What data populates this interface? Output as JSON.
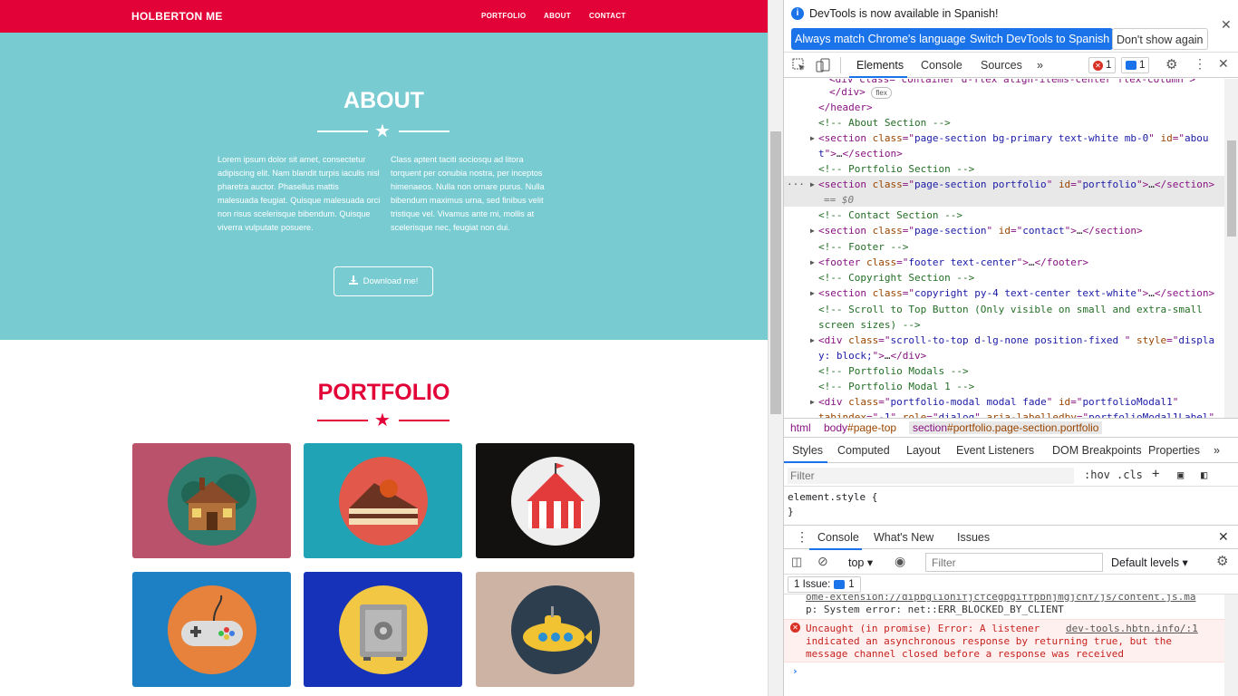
{
  "site": {
    "brand": "HOLBERTON ME",
    "nav": [
      "PORTFOLIO",
      "ABOUT",
      "CONTACT"
    ],
    "about": {
      "title": "ABOUT",
      "col1": "Lorem ipsum dolor sit amet, consectetur adipiscing elit. Nam blandit turpis iaculis nisl pharetra auctor. Phasellus mattis malesuada feugiat. Quisque malesuada orci non risus scelerisque bibendum. Quisque viverra vulputate posuere.",
      "col2": "Class aptent taciti sociosqu ad litora torquent per conubia nostra, per inceptos himenaeos. Nulla non ornare purus. Nulla bibendum maximus urna, sed finibus velit tristique vel. Vivamus ante mi, mollis at scelerisque nec, feugiat non dui.",
      "button": "Download me!"
    },
    "portfolio": {
      "title": "PORTFOLIO",
      "items": [
        {
          "name": "cabin",
          "bg": "#b9526a"
        },
        {
          "name": "cake",
          "bg": "#20a3b5"
        },
        {
          "name": "circus",
          "bg": "#131010"
        },
        {
          "name": "game",
          "bg": "#1d80c4"
        },
        {
          "name": "safe",
          "bg": "#1532b8"
        },
        {
          "name": "submarine",
          "bg": "#cdb3a3"
        }
      ]
    },
    "colors": {
      "primary": "#e30237",
      "secondary": "#78cbd1"
    }
  },
  "devtools": {
    "info": {
      "text": "DevTools is now available in Spanish!",
      "btn_match": "Always match Chrome's language",
      "btn_switch": "Switch DevTools to Spanish",
      "btn_dismiss": "Don't show again"
    },
    "tabs": [
      "Elements",
      "Console",
      "Sources"
    ],
    "error_count": "1",
    "message_count": "1",
    "breadcrumbs": {
      "html": "html",
      "body_tag": "body",
      "body_id": "#page-top",
      "section_tag": "section",
      "section_rest": "#portfolio.page-section.portfolio"
    },
    "styles_tabs": [
      "Styles",
      "Computed",
      "Layout",
      "Event Listeners",
      "DOM Breakpoints",
      "Properties"
    ],
    "styles_filter_placeholder": "Filter",
    "hov": ":hov",
    "cls": ".cls",
    "element_style": "element.style {\n}",
    "drawer_tabs": [
      "Console",
      "What's New",
      "Issues"
    ],
    "context": "top",
    "console_filter_placeholder": "Filter",
    "levels": "Default levels",
    "issues_label": "1 Issue:",
    "issues_count": "1",
    "console": {
      "line1": "ome-extension://dipbglionifjcfcegpgiffpbnjmgjcnf/js/content.js.ma",
      "line2": "p: System error: net::ERR_BLOCKED_BY_CLIENT",
      "err1": "Uncaught (in promise) Error: A listener",
      "err_src": "dev-tools.hbtn.info/:1",
      "err2": "indicated an asynchronous response by returning true, but the",
      "err3": "message channel closed before a response was received"
    }
  }
}
